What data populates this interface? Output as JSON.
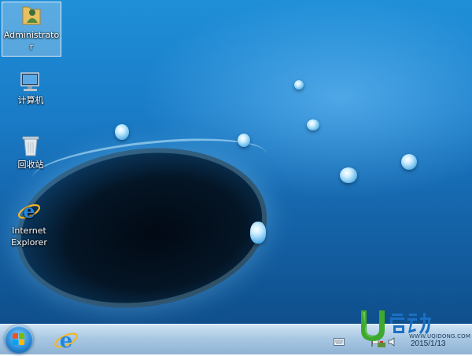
{
  "desktop": {
    "icons": [
      {
        "label": "Administrato\nr",
        "icon": "user-folder-icon"
      },
      {
        "label": "计算机",
        "icon": "computer-icon"
      },
      {
        "label": "回收站",
        "icon": "recycle-bin-icon"
      },
      {
        "label": "Internet\nExplorer",
        "icon": "internet-explorer-icon"
      }
    ]
  },
  "taskbar": {
    "start_icon": "windows-logo-icon",
    "pinned": [
      {
        "name": "Internet Explorer",
        "icon": "internet-explorer-icon"
      }
    ],
    "tray": {
      "icons": [
        "keyboard-icon",
        "flag-icon",
        "network-icon",
        "volume-icon"
      ],
      "date": "2015/1/13"
    }
  },
  "watermark": {
    "brand_text": "U启动",
    "url": "WWW.UQIDONG.COM"
  },
  "colors": {
    "desktop_blue": "#1a7cc7",
    "taskbar": "#a9c8e3",
    "brand_green": "#3ea82f",
    "brand_blue": "#1b6fc2"
  }
}
